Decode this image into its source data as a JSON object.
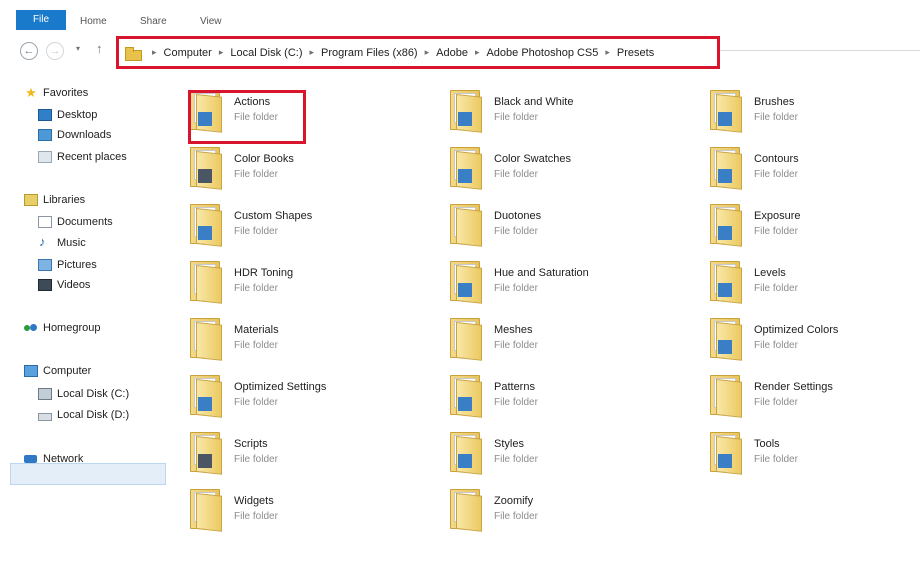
{
  "ribbon": {
    "tabs": [
      "File",
      "Home",
      "Share",
      "View"
    ]
  },
  "nav_buttons": {
    "back": "←",
    "forward": "→",
    "recent": "▾",
    "up": "↑"
  },
  "address": {
    "separator": "▸",
    "crumbs": [
      "Computer",
      "Local Disk (C:)",
      "Program Files (x86)",
      "Adobe",
      "Adobe Photoshop CS5",
      "Presets"
    ]
  },
  "navigation_pane": {
    "favorites": {
      "label": "Favorites",
      "items": [
        "Desktop",
        "Downloads",
        "Recent places"
      ]
    },
    "libraries": {
      "label": "Libraries",
      "items": [
        "Documents",
        "Music",
        "Pictures",
        "Videos"
      ]
    },
    "homegroup": {
      "label": "Homegroup"
    },
    "computer": {
      "label": "Computer",
      "items": [
        "Local Disk (C:)",
        "Local Disk (D:)"
      ]
    },
    "network": {
      "label": "Network"
    },
    "selected": "Local Disk (C:)"
  },
  "folders": [
    {
      "name": "Actions",
      "type": "File folder",
      "highlighted": true
    },
    {
      "name": "Black and White",
      "type": "File folder"
    },
    {
      "name": "Brushes",
      "type": "File folder"
    },
    {
      "name": "Color Books",
      "type": "File folder"
    },
    {
      "name": "Color Swatches",
      "type": "File folder"
    },
    {
      "name": "Contours",
      "type": "File folder"
    },
    {
      "name": "Custom Shapes",
      "type": "File folder"
    },
    {
      "name": "Duotones",
      "type": "File folder"
    },
    {
      "name": "Exposure",
      "type": "File folder"
    },
    {
      "name": "HDR Toning",
      "type": "File folder"
    },
    {
      "name": "Hue and Saturation",
      "type": "File folder"
    },
    {
      "name": "Levels",
      "type": "File folder"
    },
    {
      "name": "Materials",
      "type": "File folder"
    },
    {
      "name": "Meshes",
      "type": "File folder"
    },
    {
      "name": "Optimized Colors",
      "type": "File folder"
    },
    {
      "name": "Optimized Settings",
      "type": "File folder"
    },
    {
      "name": "Patterns",
      "type": "File folder"
    },
    {
      "name": "Render Settings",
      "type": "File folder"
    },
    {
      "name": "Scripts",
      "type": "File folder"
    },
    {
      "name": "Styles",
      "type": "File folder"
    },
    {
      "name": "Tools",
      "type": "File folder"
    },
    {
      "name": "Widgets",
      "type": "File folder"
    },
    {
      "name": "Zoomify",
      "type": "File folder"
    }
  ],
  "colors": {
    "file_tab": "#1979ca",
    "highlight_border": "#d8152c",
    "folder_yellow": "#e9c35a",
    "secondary_text": "#8d8d8d"
  }
}
